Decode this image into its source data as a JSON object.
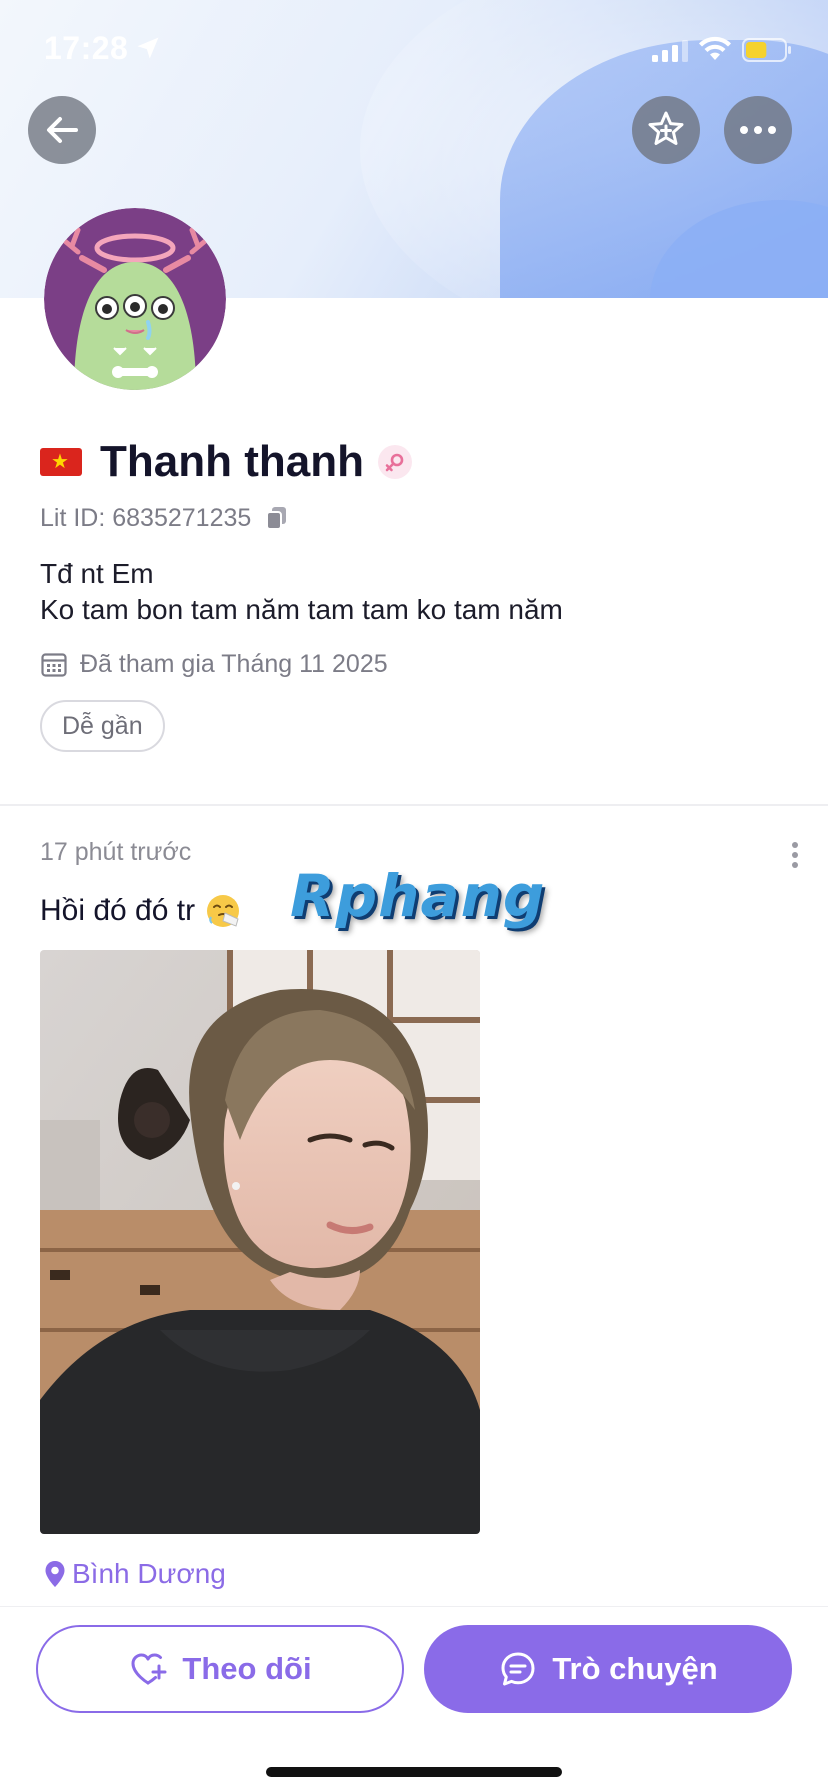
{
  "status_bar": {
    "time": "17:28",
    "location_icon": "location-arrow-icon",
    "signal_icon": "cellular-signal-icon",
    "wifi_icon": "wifi-icon",
    "battery_icon": "battery-icon",
    "battery_level": 0.55,
    "battery_color": "#f5d22e"
  },
  "header": {
    "back_icon": "arrow-left-icon",
    "favorite_icon": "star-add-icon",
    "more_icon": "ellipsis-icon"
  },
  "profile": {
    "avatar_icon": "monster-avatar",
    "flag_icon": "vietnam-flag-icon",
    "name": "Thanh thanh",
    "gender_icon": "female-icon",
    "lit_id": "Lit ID: 6835271235",
    "copy_icon": "copy-icon",
    "bio_line_1": "Tđ nt Em",
    "bio_line_2": "Ko tam bon tam năm tam tam ko tam năm",
    "calendar_icon": "calendar-icon",
    "joined": "Đã tham gia Tháng 11 2025",
    "tag": "Dễ gần"
  },
  "post": {
    "time": "17 phút trước",
    "more_icon": "vertical-dots-icon",
    "text": "Hồi đó đó tr",
    "emoji_icon": "sneezing-face-emoji",
    "watermark": "Rphang",
    "image_icon": "photo",
    "location_icon": "map-pin-icon",
    "location": "Bình Dương"
  },
  "actions": {
    "follow_icon": "heart-plus-icon",
    "follow_label": "Theo dõi",
    "chat_icon": "chat-bubble-icon",
    "chat_label": "Trò chuyện"
  },
  "colors": {
    "accent": "#8a6be8",
    "text_primary": "#14142a",
    "text_secondary": "#7c7c87",
    "flag_red": "#da251d",
    "flag_star": "#ffd600"
  }
}
